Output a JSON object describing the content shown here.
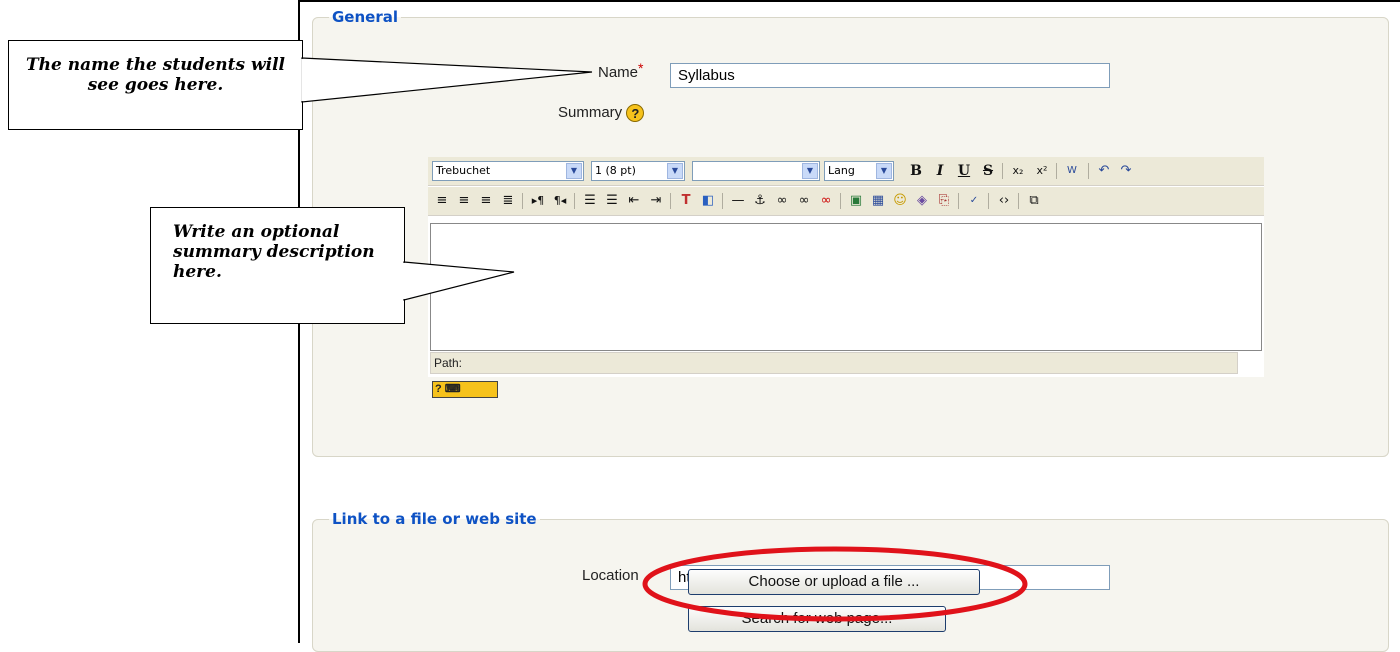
{
  "general": {
    "legend": "General",
    "name_label": "Name",
    "required_mark": "*",
    "name_value": "Syllabus",
    "summary_label": "Summary",
    "help_glyph": "?"
  },
  "editor": {
    "font_value": "Trebuchet",
    "size_value": "1 (8 pt)",
    "style_value": "",
    "lang_value": "Lang",
    "path_label": "Path:",
    "keyboard_help_glyph": "? ⌨"
  },
  "link": {
    "legend": "Link to a file or web site",
    "location_label": "Location",
    "location_value": "http://",
    "choose_button": "Choose or upload a file ...",
    "search_button": "Search for web page..."
  },
  "callouts": {
    "name_text": "The name the students will see goes here.",
    "summary_text": "Write an optional summary description here."
  },
  "colors": {
    "legend": "#0e52c4",
    "highlight_ellipse": "#e0121a",
    "required": "#cc0000"
  }
}
